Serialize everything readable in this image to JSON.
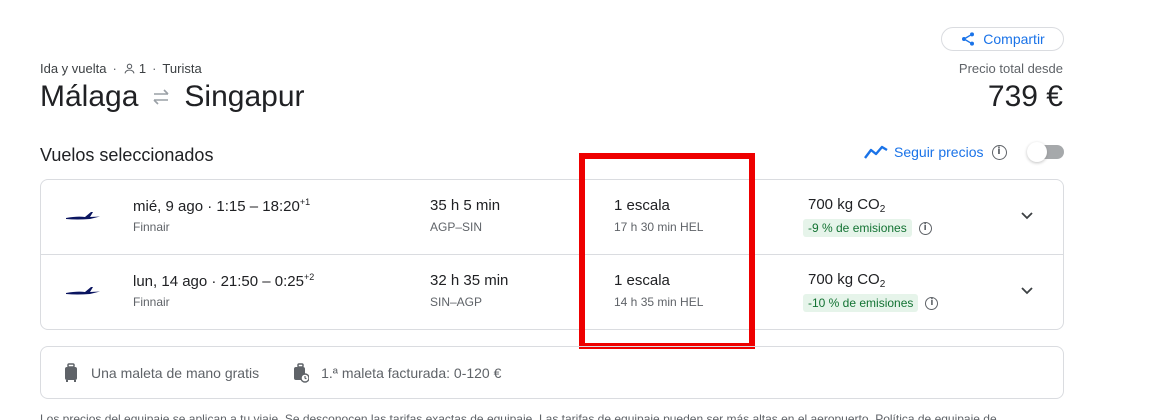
{
  "header": {
    "share_label": "Compartir",
    "trip_type": "Ida y vuelta",
    "passengers": "1",
    "cabin": "Turista",
    "origin": "Málaga",
    "destination": "Singapur",
    "price_label": "Precio total desde",
    "price": "739 €"
  },
  "section": {
    "title": "Vuelos seleccionados",
    "track_label": "Seguir precios",
    "track_enabled": false
  },
  "flights": [
    {
      "date": "mié, 9 ago",
      "time_range": "1:15 – 18:20",
      "day_offset": "+1",
      "airline": "Finnair",
      "duration": "35 h 5 min",
      "airports": "AGP–SIN",
      "stops": "1 escala",
      "layover": "17 h 30 min HEL",
      "co2_value": "700 kg CO",
      "co2_sub": "2",
      "emissions": "-9 % de emisiones"
    },
    {
      "date": "lun, 14 ago",
      "time_range": "21:50 – 0:25",
      "day_offset": "+2",
      "airline": "Finnair",
      "duration": "32 h 35 min",
      "airports": "SIN–AGP",
      "stops": "1 escala",
      "layover": "14 h 35 min HEL",
      "co2_value": "700 kg CO",
      "co2_sub": "2",
      "emissions": "-10 % de emisiones"
    }
  ],
  "baggage": {
    "carry_on": "Una maleta de mano gratis",
    "checked": "1.ª maleta facturada: 0-120 €"
  },
  "footnote": "Los precios del equipaje se aplican a tu viaje. Se desconocen las tarifas exactas de equipaje. Las tarifas de equipaje pueden ser más altas en el aeropuerto. Política de equipaje de",
  "colors": {
    "accent": "#1a73e8",
    "emissions_badge_bg": "#e6f4ea",
    "emissions_badge_text": "#137333",
    "highlight_box": "#ee0000",
    "airline_logo": "#0b1560"
  },
  "icons": [
    "share-icon",
    "person-icon",
    "swap-arrows-icon",
    "trend-icon",
    "info-icon",
    "finnair-logo",
    "chevron-down-icon",
    "carry-on-bag-icon",
    "checked-bag-icon"
  ]
}
